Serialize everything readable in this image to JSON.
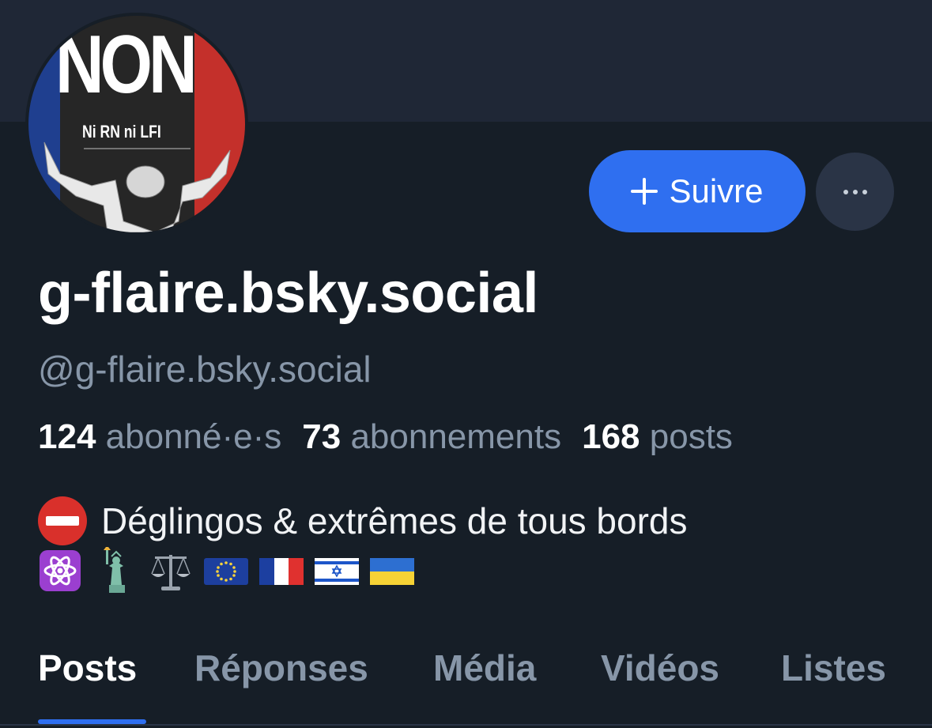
{
  "avatar": {
    "title": "NON",
    "subtitle": "Ni RN ni LFI"
  },
  "actions": {
    "follow_label": "Suivre",
    "more_icon": "ellipsis-icon",
    "follow_icon": "plus-icon"
  },
  "profile": {
    "display_name": "g-flaire.bsky.social",
    "handle": "@g-flaire.bsky.social"
  },
  "stats": [
    {
      "value": "124",
      "label": "abonné·e·s"
    },
    {
      "value": "73",
      "label": "abonnements"
    },
    {
      "value": "168",
      "label": "posts"
    }
  ],
  "bio": {
    "icon": "no-entry-icon",
    "text": "Déglingos & extrêmes de tous bords",
    "emojis": [
      "atom-symbol-icon",
      "statue-of-liberty-icon",
      "balance-scale-icon",
      "eu-flag-icon",
      "france-flag-icon",
      "israel-flag-icon",
      "ukraine-flag-icon"
    ]
  },
  "tabs": [
    {
      "label": "Posts",
      "active": true
    },
    {
      "label": "Réponses",
      "active": false
    },
    {
      "label": "Média",
      "active": false
    },
    {
      "label": "Vidéos",
      "active": false
    },
    {
      "label": "Listes",
      "active": false
    }
  ],
  "colors": {
    "background": "#161e27",
    "banner": "#1f2736",
    "accent": "#2f6ff0",
    "muted_text": "#8796a8"
  }
}
